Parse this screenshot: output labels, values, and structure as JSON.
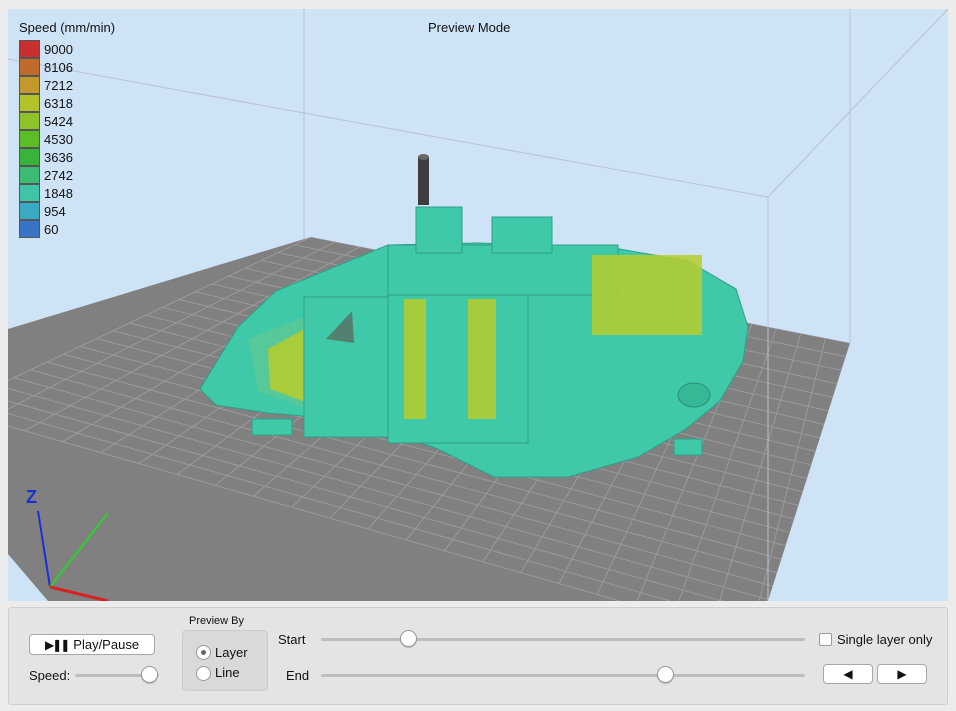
{
  "viewport": {
    "legend": {
      "title": "Speed (mm/min)",
      "items": [
        {
          "label": "9000",
          "color": "#c8302f"
        },
        {
          "label": "8106",
          "color": "#c16a2d"
        },
        {
          "label": "7212",
          "color": "#c4992b"
        },
        {
          "label": "6318",
          "color": "#b4c22a"
        },
        {
          "label": "5424",
          "color": "#8fc228"
        },
        {
          "label": "4530",
          "color": "#5cbd27"
        },
        {
          "label": "3636",
          "color": "#39b33a"
        },
        {
          "label": "2742",
          "color": "#3dbb74"
        },
        {
          "label": "1848",
          "color": "#3fc4a7"
        },
        {
          "label": "954",
          "color": "#3aa9c2"
        },
        {
          "label": "60",
          "color": "#3a73c5"
        }
      ]
    },
    "mode_title": "Preview Mode",
    "axis_z_label": "Z",
    "model_color": "#3fc9a8",
    "infill_color": "#b6cc2c"
  },
  "panel": {
    "play_pause_label": "Play/Pause",
    "speed_label": "Speed:",
    "speed_level": 0.88,
    "preview_by": {
      "title": "Preview By",
      "options": [
        {
          "label": "Layer",
          "selected": true
        },
        {
          "label": "Line",
          "selected": false
        }
      ]
    },
    "start_label": "Start",
    "start_level": 0.18,
    "end_label": "End",
    "end_level": 0.71,
    "single_layer_label": "Single layer only",
    "single_layer_checked": false
  }
}
